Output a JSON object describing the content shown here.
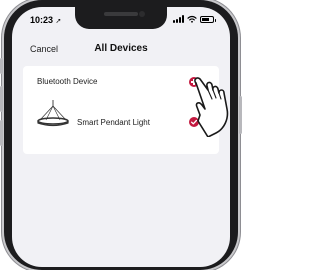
{
  "status_bar": {
    "time": "10:23",
    "location_glyph": "➚"
  },
  "nav": {
    "cancel_label": "Cancel",
    "title": "All Devices"
  },
  "card": {
    "section_label": "Bluetooth Device",
    "device": {
      "name": "Smart Pendant Light",
      "icon": "pendant-light-icon",
      "selected": true
    }
  },
  "icons": {
    "add": "plus-circle-icon",
    "check": "check-circle-icon",
    "pointer": "tapping-hand-icon"
  },
  "colors": {
    "accent": "#c3193f",
    "screen_bg": "#f1f1f5",
    "card_bg": "#ffffff"
  }
}
